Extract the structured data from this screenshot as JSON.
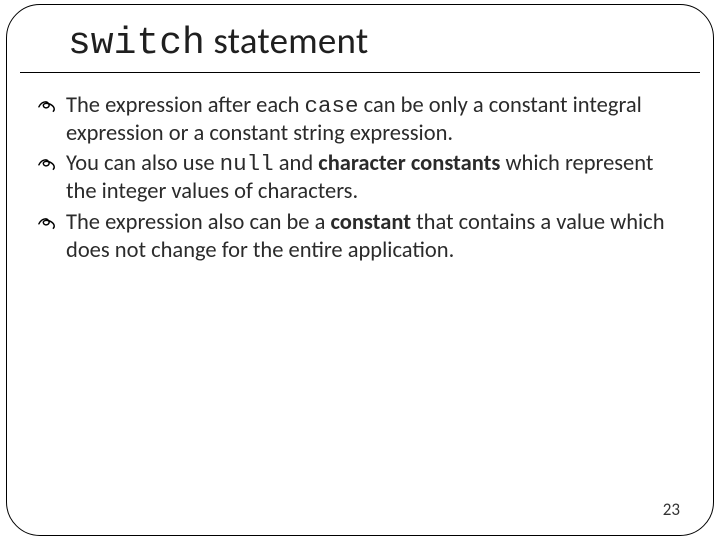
{
  "title": {
    "code": "switch",
    "rest": " statement"
  },
  "bullets": [
    {
      "pre": "The expression after each ",
      "code": "case",
      "mid": " can be only a constant integral expression or a constant string expression.",
      "bold1": "",
      "mid2": "",
      "bold2": "",
      "tail": ""
    },
    {
      "pre": "You can also use ",
      "code": "null",
      "mid": " and ",
      "bold1": "character constants",
      "mid2": " which represent the integer values of characters.",
      "bold2": "",
      "tail": ""
    },
    {
      "pre": "The expression also can be a ",
      "code": "",
      "mid": "",
      "bold1": "constant",
      "mid2": " that contains a value which does not change for the entire application.",
      "bold2": "",
      "tail": ""
    }
  ],
  "page_number": "23"
}
